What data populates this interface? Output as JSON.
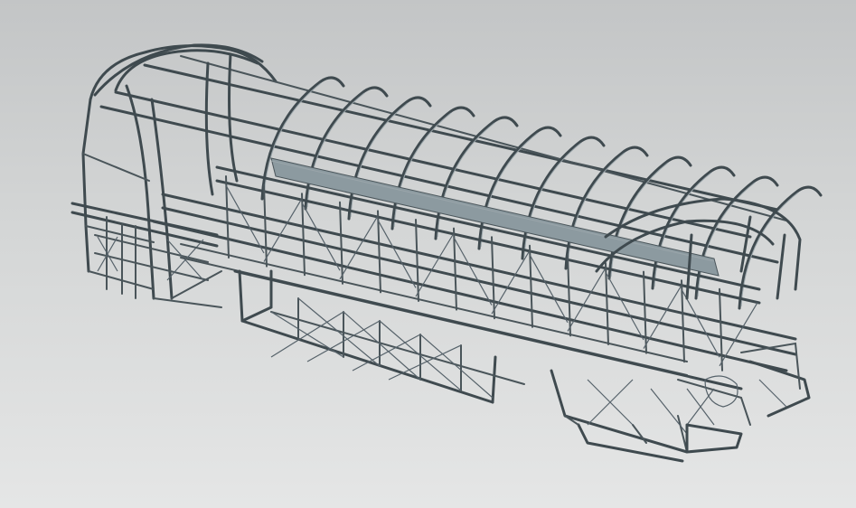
{
  "viewport": {
    "background_top": "#c3c5c6",
    "background_bottom": "#e5e6e6",
    "model_color": "#3f4a4f",
    "model_label": "bus-chassis-frame-wireframe"
  }
}
